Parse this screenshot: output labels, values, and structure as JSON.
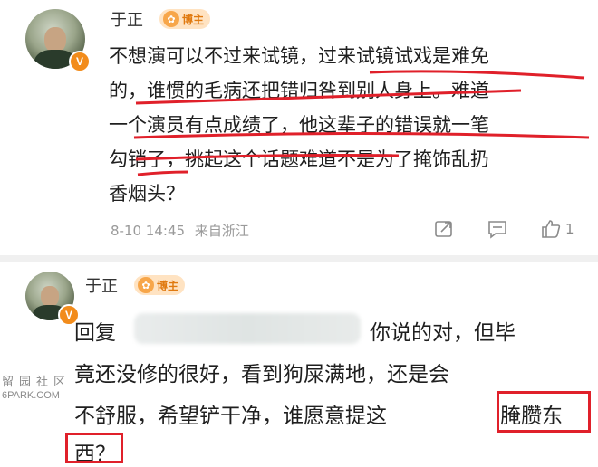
{
  "comment_1": {
    "username": "于正",
    "tag_label": "博主",
    "verified_badge": "V",
    "lines": [
      "不想演可以不过来试镜，过来试镜试戏是难免",
      "的，谁惯的毛病还把错归咎到别人身上。难道",
      "一个演员有点成绩了，他这辈子的错误就一笔",
      "勾销了，挑起这个话题难道不是为了掩饰乱扔",
      "香烟头？"
    ],
    "timestamp": "8-10 14:45",
    "location": "来自浙江",
    "like_count": "1",
    "icons": [
      "share-icon",
      "comment-icon",
      "like-icon"
    ]
  },
  "comment_2": {
    "username": "于正",
    "tag_label": "博主",
    "verified_badge": "V",
    "reply_prefix": "回复",
    "line1_tail": "你说的对，但毕",
    "line2": "竟还没修的很好，看到狗屎满地，还是会",
    "line3_head": "不舒服，希望铲干净，谁愿意提这",
    "line3_boxed": "腌臜东",
    "line4_boxed": "西？"
  },
  "watermark": {
    "line1": "留园社区",
    "line2": "6PARK.COM"
  },
  "colors": {
    "annotation_red": "#e0202a",
    "tag_bg": "#ffe3c2",
    "tag_text": "#e07a10",
    "badge": "#f28c1c",
    "meta_text": "#9a9a9a"
  }
}
